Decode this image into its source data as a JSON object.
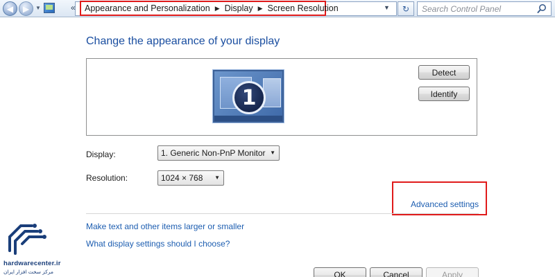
{
  "address_bar": {
    "overflow_chevron": "«",
    "breadcrumbs": [
      "Appearance and Personalization",
      "Display",
      "Screen Resolution"
    ],
    "search_placeholder": "Search Control Panel"
  },
  "main": {
    "title": "Change the appearance of your display",
    "monitor_number": "1",
    "detect_label": "Detect",
    "identify_label": "Identify",
    "display_label": "Display:",
    "display_value": "1. Generic Non-PnP Monitor",
    "resolution_label": "Resolution:",
    "resolution_value": "1024 × 768",
    "advanced_link": "Advanced settings",
    "link_text_size": "Make text and other items larger or smaller",
    "link_help": "What display settings should I choose?"
  },
  "footer": {
    "ok_label": "OK",
    "cancel_label": "Cancel",
    "apply_label": "Apply"
  },
  "watermark": {
    "domain": "hardwarecenter.ir",
    "tagline": "مرکز سخت افزار ایران"
  },
  "colors": {
    "title_blue": "#1a4ea0",
    "link_blue": "#1c5db0",
    "highlight_red": "#e01a1a"
  }
}
